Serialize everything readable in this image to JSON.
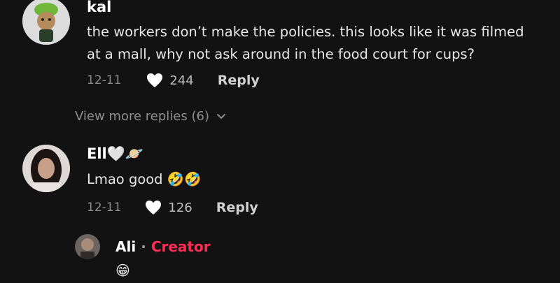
{
  "colors": {
    "background": "#121212",
    "creator_accent": "#fe2c55"
  },
  "comments": [
    {
      "username": "kal",
      "text_line1": "the workers don’t make the policies. this looks like it was filmed",
      "text_line2": "at a mall, why not ask around in the food court for cups?",
      "date": "12-11",
      "likes": "244",
      "reply_label": "Reply"
    },
    {
      "username": "Ell🤍🪐",
      "text": "Lmao good 🤣🤣",
      "date": "12-11",
      "likes": "126",
      "reply_label": "Reply"
    }
  ],
  "view_more": {
    "label": "View more replies (6)",
    "icon": "chevron-down-icon"
  },
  "creator_reply": {
    "username": "Ali",
    "separator": "·",
    "badge": "Creator",
    "text": "😁"
  }
}
